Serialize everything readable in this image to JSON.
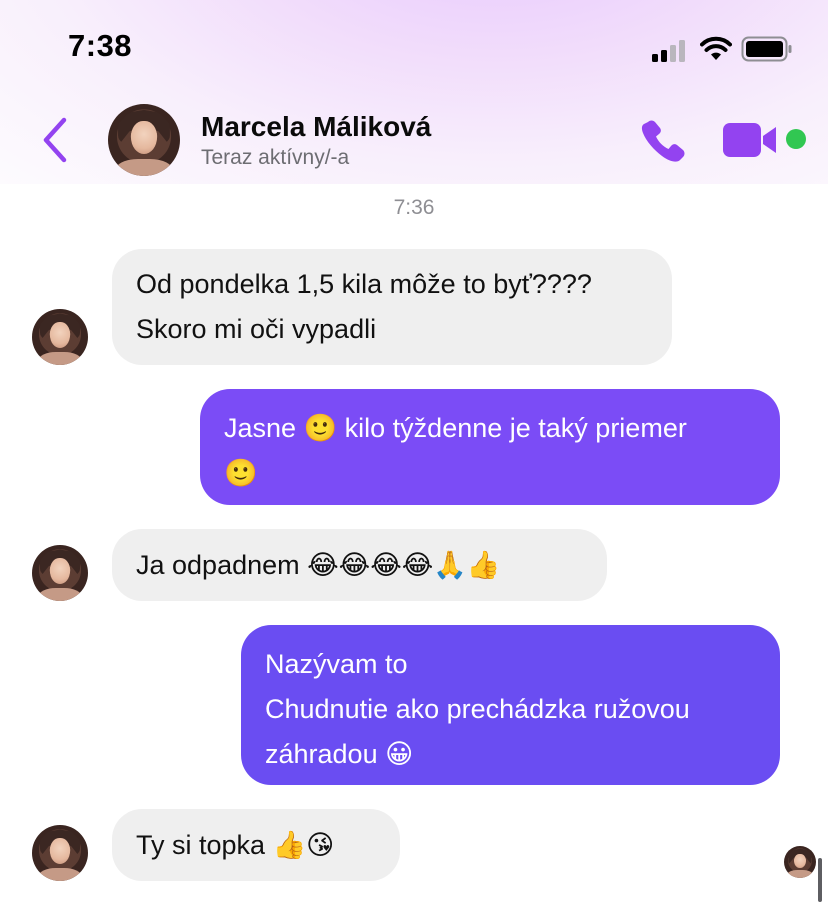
{
  "status_bar": {
    "time": "7:38"
  },
  "header": {
    "contact_name": "Marcela Máliková",
    "contact_status": "Teraz aktívny/-a",
    "back_icon": "chevron-left-icon",
    "call_icon": "phone-icon",
    "video_icon": "video-camera-icon",
    "accent_color": "#9343f0",
    "online_color": "#31c752"
  },
  "timestamp": "7:36",
  "messages": [
    {
      "direction": "incoming",
      "lines": [
        "Od pondelka 1,5 kila môže to byť????",
        "Skoro mi oči vypadli"
      ]
    },
    {
      "direction": "outgoing",
      "lines": [
        "Jasne 🙂 kilo týždenne je taký priemer",
        "🙂"
      ],
      "color": "#7b4cf6"
    },
    {
      "direction": "incoming",
      "lines": [
        "Ja odpadnem 😂😂😂😂🙏👍"
      ]
    },
    {
      "direction": "outgoing",
      "lines": [
        "Nazývam to",
        "Chudnutie ako prechádzka ružovou",
        "záhradou 😀"
      ],
      "color": "#6a4df2"
    },
    {
      "direction": "incoming",
      "lines": [
        "Ty si topka 👍😘"
      ]
    }
  ]
}
